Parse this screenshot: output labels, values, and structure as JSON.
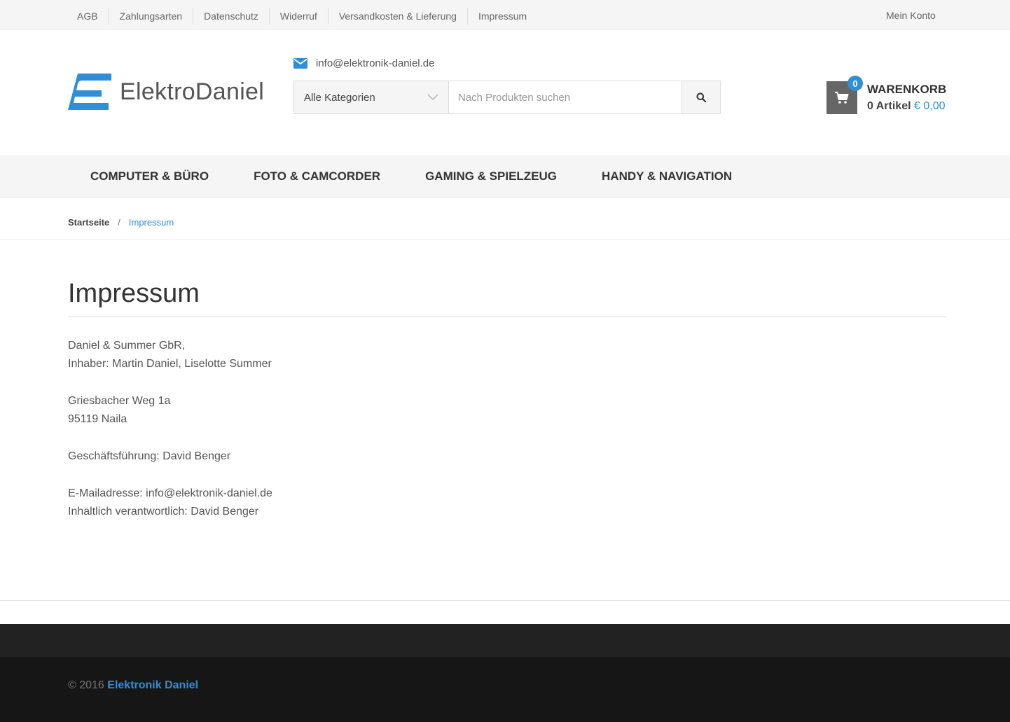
{
  "topbar": {
    "links": [
      "AGB",
      "Zahlungsarten",
      "Datenschutz",
      "Widerruf",
      "Versandkosten & Lieferung",
      "Impressum"
    ],
    "account": "Mein Konto"
  },
  "header": {
    "logo_text": "ElektroDaniel",
    "email": "info@elektronik-daniel.de",
    "search": {
      "category": "Alle Kategorien",
      "placeholder": "Nach Produkten suchen"
    },
    "cart": {
      "badge": "0",
      "title": "WARENKORB",
      "items": "0 Artikel",
      "price": "€ 0,00"
    }
  },
  "nav": {
    "items": [
      "COMPUTER & BÜRO",
      "FOTO & CAMCORDER",
      "GAMING & SPIELZEUG",
      "HANDY & NAVIGATION"
    ]
  },
  "breadcrumb": {
    "home": "Startseite",
    "separator": "/",
    "current": "Impressum"
  },
  "page": {
    "title": "Impressum",
    "paragraphs": [
      [
        "Daniel & Summer GbR,",
        "Inhaber: Martin Daniel, Liselotte Summer"
      ],
      [
        "Griesbacher Weg 1a",
        "95119 Naila"
      ],
      [
        "Geschäftsführung: David Benger"
      ],
      [
        "E-Mailadresse: info@elektronik-daniel.de",
        "Inhaltlich verantwortlich: David Benger"
      ]
    ]
  },
  "footer": {
    "copyright": "© 2016",
    "brand": "Elektronik Daniel"
  },
  "colors": {
    "accent": "#2e8ed8",
    "topbar_bg": "#f5f5f5",
    "footer_top": "#222222",
    "footer_bottom": "#161616",
    "cart_box": "#666666"
  }
}
